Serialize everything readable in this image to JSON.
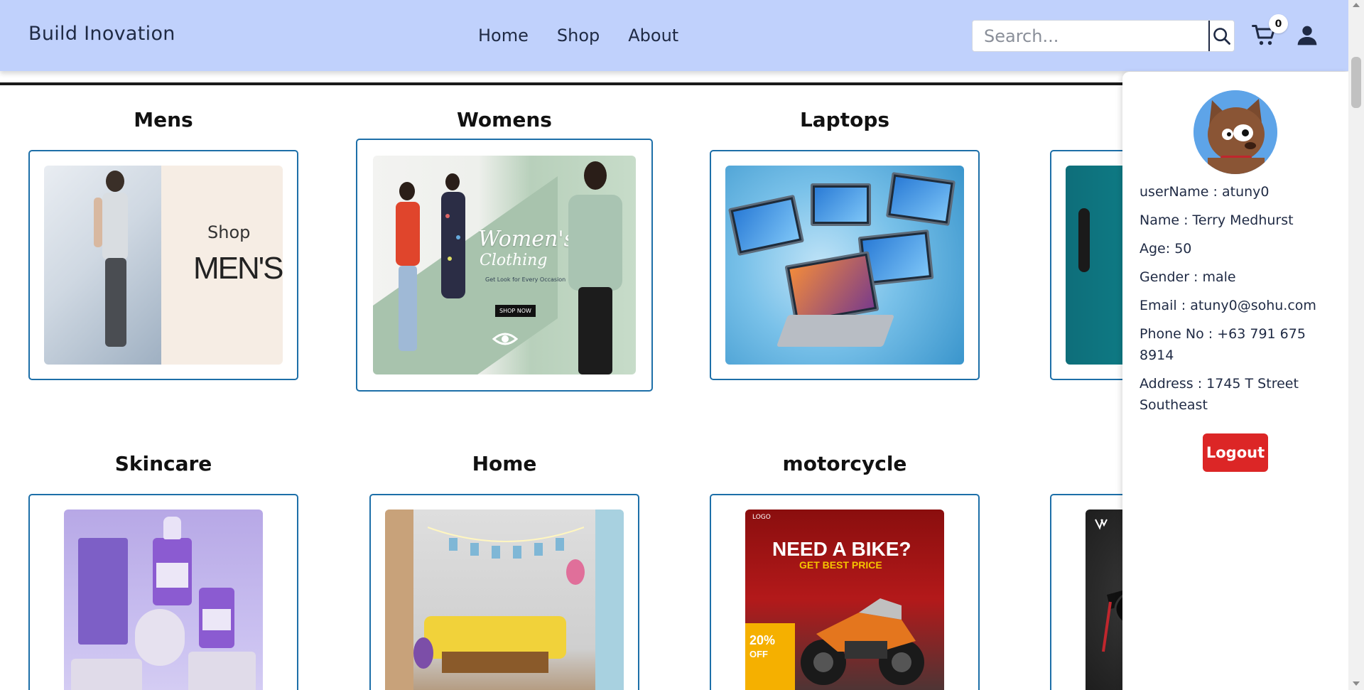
{
  "header": {
    "brand": "Build Inovation",
    "nav": [
      "Home",
      "Shop",
      "About"
    ],
    "search_placeholder": "Search...",
    "cart_count": "0",
    "colors": {
      "header_bg": "#c0d1fc",
      "card_border": "#1d6fa8",
      "logout_bg": "#dc2626"
    }
  },
  "categories": [
    {
      "title": "Mens"
    },
    {
      "title": "Womens"
    },
    {
      "title": "Laptops"
    },
    {
      "title": "Skincare"
    },
    {
      "title": "Home"
    },
    {
      "title": "motorcycle"
    }
  ],
  "banners": {
    "mens_shop": "Shop",
    "mens_mens": "MEN'S",
    "womens_title": "Women's",
    "womens_sub": "Clothing",
    "womens_small": "Get Look for Every Occasion",
    "womens_shop": "SHOP NOW",
    "moto_logo": "LOGO",
    "moto_title": "NEED A BIKE?",
    "moto_sub": "GET BEST PRICE",
    "moto_pct": "20%",
    "moto_off": "OFF"
  },
  "profile": {
    "username": "userName : atuny0",
    "name": "Name : Terry Medhurst",
    "age": "Age: 50",
    "gender": "Gender : male",
    "email": "Email : atuny0@sohu.com",
    "phone": "Phone No : +63 791 675 8914",
    "address": "Address : 1745 T Street Southeast",
    "logout": "Logout"
  }
}
